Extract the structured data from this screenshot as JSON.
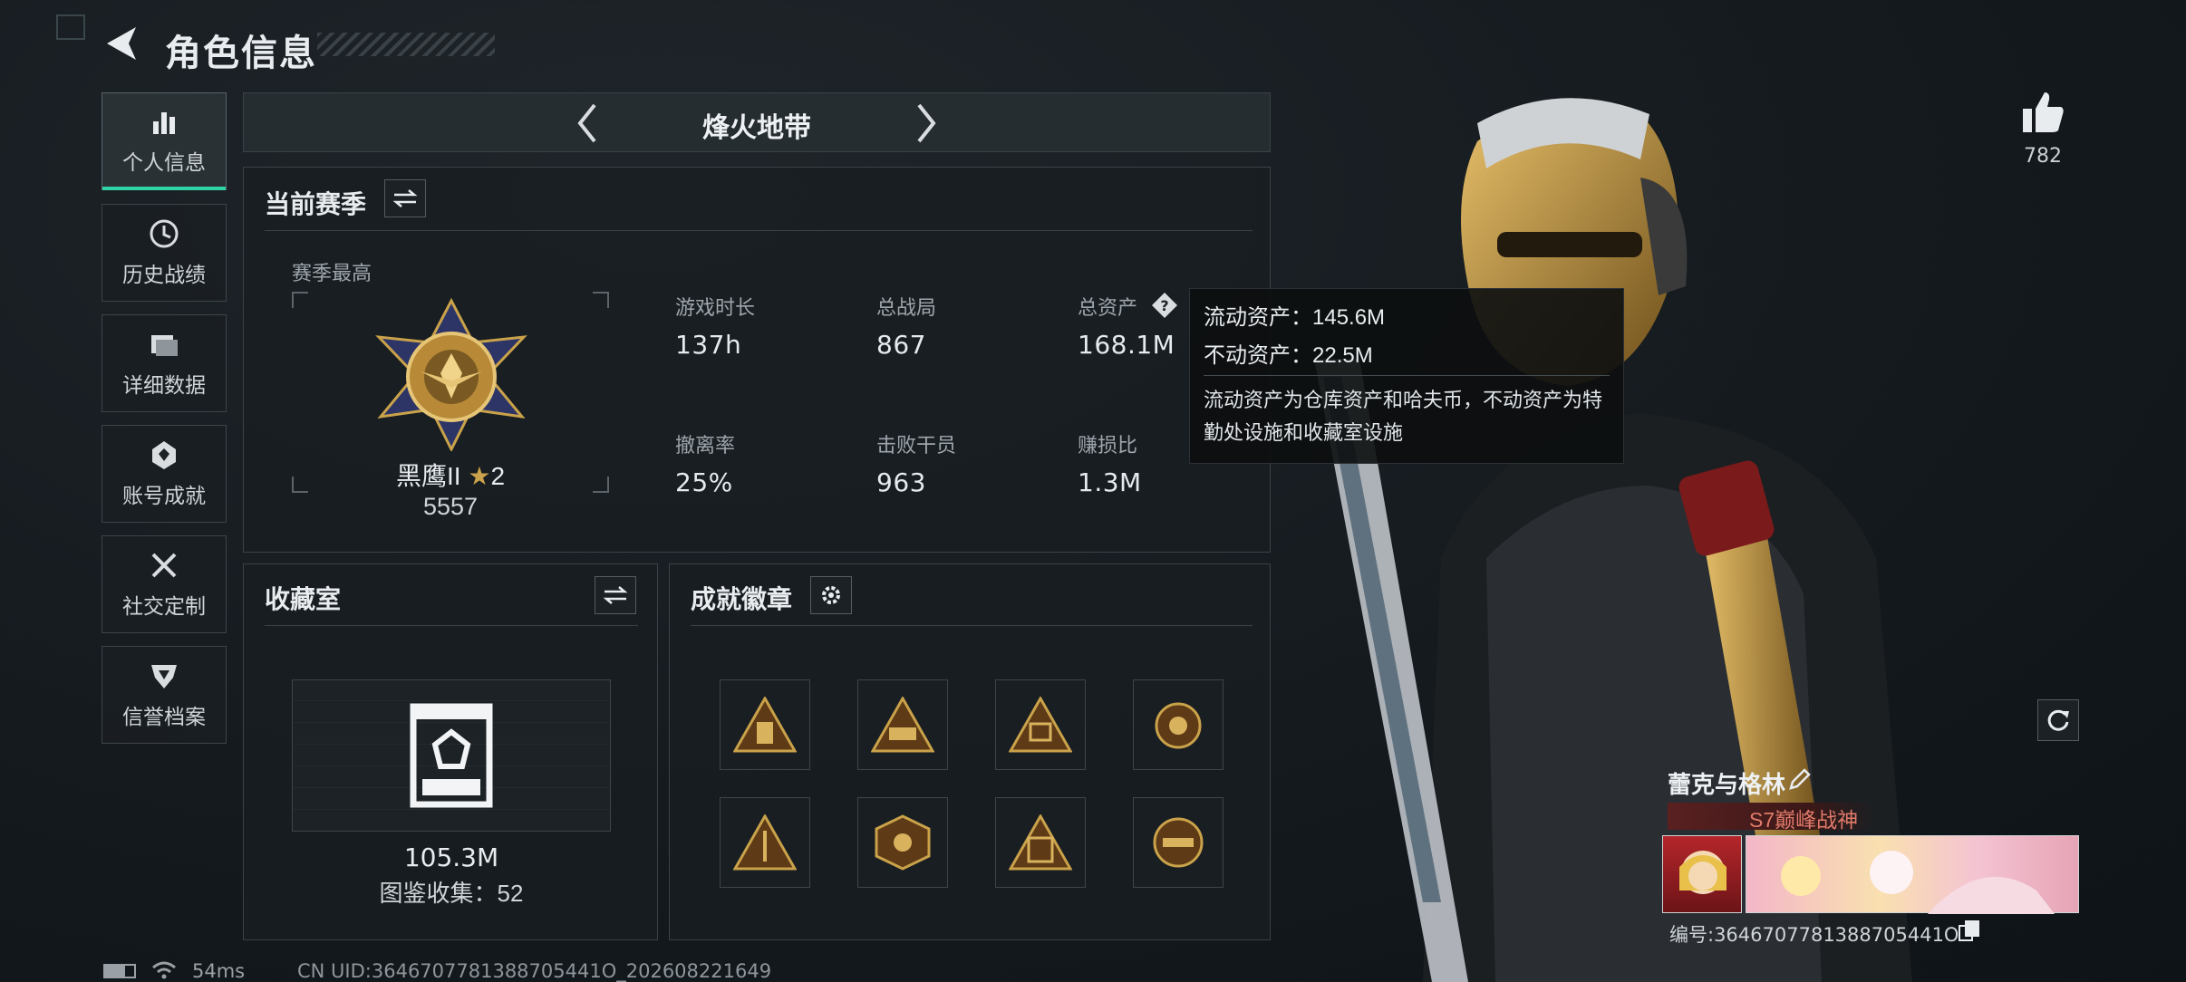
{
  "header": {
    "title": "角色信息"
  },
  "sidebar": {
    "items": [
      {
        "label": "个人信息",
        "icon": "bar-chart-icon",
        "active": true
      },
      {
        "label": "历史战绩",
        "icon": "clock-history-icon"
      },
      {
        "label": "详细数据",
        "icon": "folder-icon"
      },
      {
        "label": "账号成就",
        "icon": "achievement-icon"
      },
      {
        "label": "社交定制",
        "icon": "tools-icon"
      },
      {
        "label": "信誉档案",
        "icon": "reputation-icon"
      }
    ]
  },
  "mode_selector": {
    "label": "烽火地带"
  },
  "season": {
    "title": "当前赛季",
    "best_label": "赛季最高",
    "rank_name": "黑鹰II",
    "rank_stars": "2",
    "rank_points": "5557",
    "stats": [
      {
        "label": "游戏时长",
        "value": "137h"
      },
      {
        "label": "总战局",
        "value": "867"
      },
      {
        "label": "总资产",
        "value": "168.1M"
      },
      {
        "label": "撤离率",
        "value": "25%"
      },
      {
        "label": "击败干员",
        "value": "963"
      },
      {
        "label": "赚损比",
        "value": "1.3M"
      }
    ]
  },
  "tooltip": {
    "liquid": "流动资产：145.6M",
    "fixed": "不动资产：22.5M",
    "description": "流动资产为仓库资产和哈夫币，不动资产为特勤处设施和收藏室设施"
  },
  "collection": {
    "title": "收藏室",
    "value": "105.3M",
    "count": "图鉴收集：52"
  },
  "badges": {
    "title": "成就徽章",
    "items": [
      "badge-1",
      "badge-2",
      "badge-3",
      "badge-4",
      "badge-5",
      "badge-6",
      "badge-7",
      "badge-8"
    ]
  },
  "likes": {
    "count": "782"
  },
  "player": {
    "name": "蕾克与格林",
    "title_badge": "S7巅峰战神",
    "id_label": "编号:3646707781388705441O"
  },
  "status": {
    "ping": "54ms",
    "uid": "CN UID:3646707781388705441O_202608221649"
  },
  "colors": {
    "accent": "#2fd3a5",
    "gold": "#c9a24a",
    "panel": "#181d21"
  }
}
